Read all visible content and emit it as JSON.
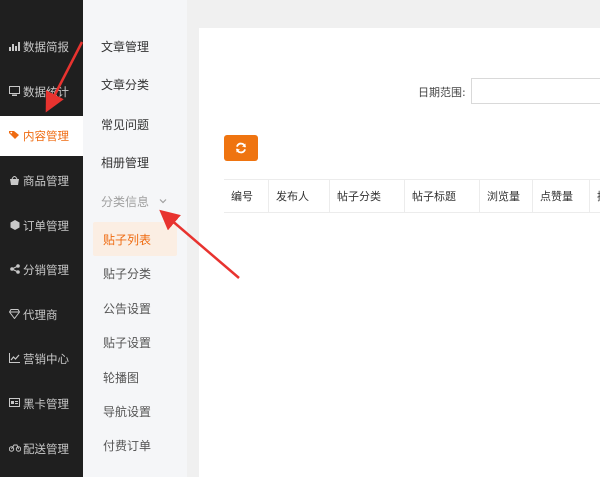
{
  "sidebar": {
    "items": [
      {
        "label": "数据简报",
        "icon": "bar-chart-icon"
      },
      {
        "label": "数据统计",
        "icon": "monitor-icon"
      },
      {
        "label": "内容管理",
        "icon": "tag-icon",
        "active": true
      },
      {
        "label": "商品管理",
        "icon": "shopping-bag-icon"
      },
      {
        "label": "订单管理",
        "icon": "hexagon-icon"
      },
      {
        "label": "分销管理",
        "icon": "share-icon"
      },
      {
        "label": "代理商",
        "icon": "diamond-icon"
      },
      {
        "label": "营销中心",
        "icon": "line-chart-icon"
      },
      {
        "label": "黑卡管理",
        "icon": "card-icon"
      },
      {
        "label": "配送管理",
        "icon": "motorcycle-icon"
      }
    ]
  },
  "submenu": {
    "items": [
      "文章管理",
      "文章分类",
      "常见问题",
      "相册管理"
    ],
    "group_label": "分类信息",
    "children": [
      "贴子列表",
      "贴子分类",
      "公告设置",
      "贴子设置",
      "轮播图",
      "导航设置",
      "付费订单"
    ]
  },
  "filter": {
    "date_label": "日期范围:"
  },
  "table": {
    "columns": [
      "编号",
      "发布人",
      "帖子分类",
      "帖子标题",
      "浏览量",
      "点赞量",
      "操"
    ]
  },
  "colors": {
    "sidebar_bg": "#1f1f1f",
    "accent": "#ef6b11",
    "arrow": "#e8332f"
  }
}
